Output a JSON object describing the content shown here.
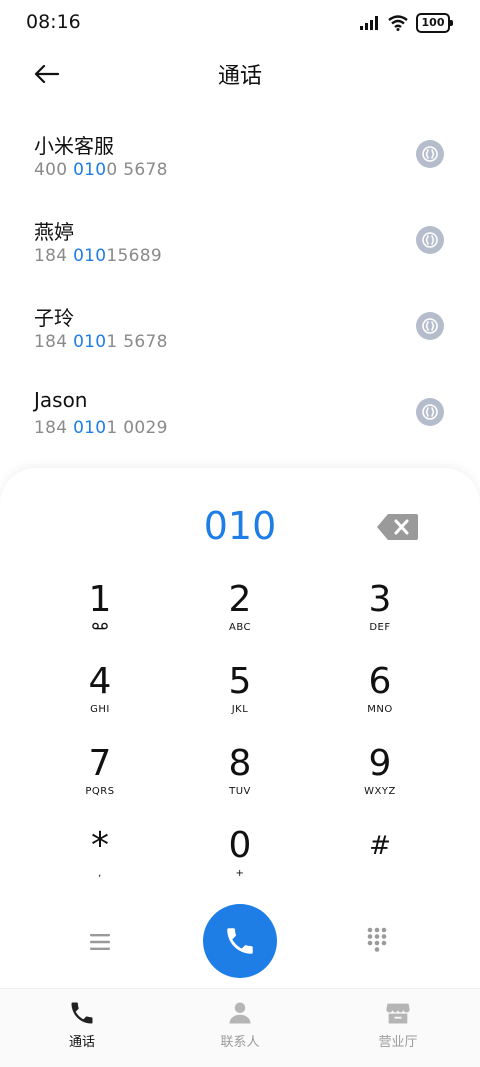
{
  "status_bar": {
    "time": "08:16",
    "battery": "100"
  },
  "header": {
    "title": "通话"
  },
  "contacts": [
    {
      "name": "小米客服",
      "number_parts": [
        "400 ",
        "010",
        "0 5678"
      ]
    },
    {
      "name": "燕婷",
      "number_parts": [
        "184 ",
        "010",
        "15689"
      ]
    },
    {
      "name": "子玲",
      "number_parts": [
        "184 ",
        "010",
        "1 5678"
      ]
    },
    {
      "name": "Jason",
      "number_parts": [
        "184 ",
        "010",
        "1 0029"
      ]
    }
  ],
  "dialpad": {
    "input_value": "010",
    "keys": [
      {
        "digit": "1",
        "letters": ""
      },
      {
        "digit": "2",
        "letters": "ABC"
      },
      {
        "digit": "3",
        "letters": "DEF"
      },
      {
        "digit": "4",
        "letters": "GHI"
      },
      {
        "digit": "5",
        "letters": "JKL"
      },
      {
        "digit": "6",
        "letters": "MNO"
      },
      {
        "digit": "7",
        "letters": "PQRS"
      },
      {
        "digit": "8",
        "letters": "TUV"
      },
      {
        "digit": "9",
        "letters": "WXYZ"
      },
      {
        "digit": "*",
        "letters": ","
      },
      {
        "digit": "0",
        "letters": "+"
      },
      {
        "digit": "#",
        "letters": ""
      }
    ]
  },
  "bottom_nav": {
    "items": [
      {
        "label": "通话",
        "icon": "phone-icon",
        "active": true
      },
      {
        "label": "联系人",
        "icon": "person-icon",
        "active": false
      },
      {
        "label": "营业厅",
        "icon": "store-icon",
        "active": false
      }
    ]
  },
  "colors": {
    "accent": "#1f7de6",
    "muted": "#8a8a8a",
    "icon_gray": "#b5bccb"
  }
}
